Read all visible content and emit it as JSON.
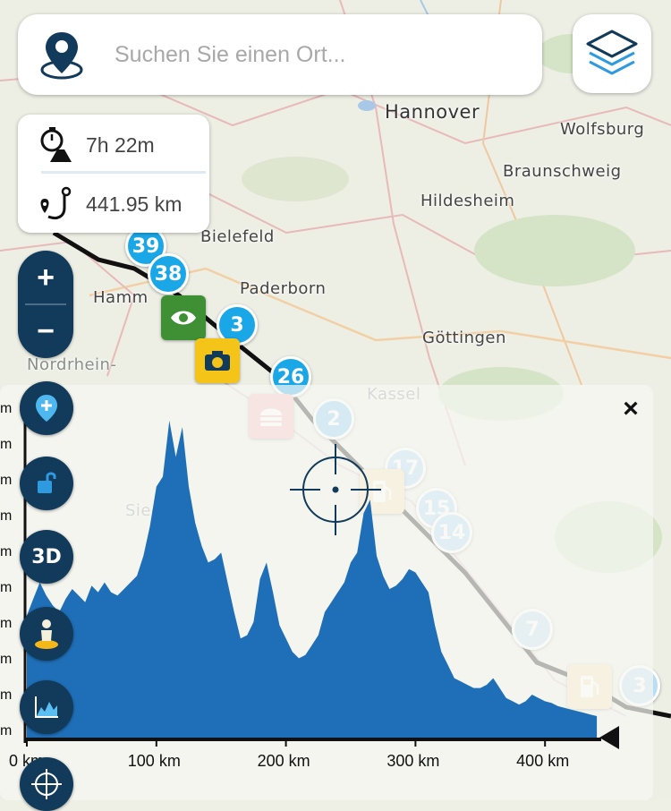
{
  "search": {
    "placeholder": "Suchen Sie einen Ort..."
  },
  "icons": {
    "search_pin": "location-pin-globe-icon",
    "layers": "layers-icon",
    "duration": "stopwatch-road-icon",
    "distance": "route-hook-icon",
    "zoom_in": "plus-icon",
    "zoom_out": "minus-icon",
    "add_waypoint": "map-pin-plus-icon",
    "lock": "unlock-icon",
    "street_view": "person-icon",
    "elevation": "elevation-chart-icon",
    "crosshair": "crosshair-icon",
    "close": "close-icon"
  },
  "route_info": {
    "duration": "7h 22m",
    "distance": "441.95 km"
  },
  "controls": {
    "zoom_in": "+",
    "zoom_out": "−",
    "view_3d": "3D",
    "close": "×"
  },
  "map": {
    "labels": [
      {
        "text": "Hannover",
        "x": 430,
        "y": 113,
        "cls": "big"
      },
      {
        "text": "Wolfsburg",
        "x": 626,
        "y": 134,
        "cls": ""
      },
      {
        "text": "Braunschweig",
        "x": 562,
        "y": 181,
        "cls": ""
      },
      {
        "text": "Hildesheim",
        "x": 470,
        "y": 214,
        "cls": ""
      },
      {
        "text": "Bielefeld",
        "x": 224,
        "y": 254,
        "cls": ""
      },
      {
        "text": "Paderborn",
        "x": 268,
        "y": 312,
        "cls": ""
      },
      {
        "text": "Hamm",
        "x": 104,
        "y": 322,
        "cls": ""
      },
      {
        "text": "Göttingen",
        "x": 472,
        "y": 367,
        "cls": ""
      },
      {
        "text": "Nordrhein-",
        "x": 30,
        "y": 397,
        "cls": "faint"
      },
      {
        "text": "Kassel",
        "x": 410,
        "y": 430,
        "cls": "faint"
      },
      {
        "text": "Siegen",
        "x": 140,
        "y": 560,
        "cls": "faint"
      }
    ],
    "route_markers": [
      {
        "label": "39",
        "x": 140,
        "y": 252,
        "color": "#1aa7e8"
      },
      {
        "label": "38",
        "x": 165,
        "y": 283,
        "color": "#1aa7e8"
      },
      {
        "label": "3",
        "x": 242,
        "y": 340,
        "color": "#1aa7e8"
      },
      {
        "label": "26",
        "x": 302,
        "y": 398,
        "color": "#1aa7e8"
      },
      {
        "label": "2",
        "x": 350,
        "y": 445,
        "color": "#7ec8f0"
      },
      {
        "label": "17",
        "x": 430,
        "y": 500,
        "color": "#a8d8f3"
      },
      {
        "label": "15",
        "x": 465,
        "y": 545,
        "color": "#a8d8f3"
      },
      {
        "label": "14",
        "x": 482,
        "y": 572,
        "color": "#a8d8f3"
      },
      {
        "label": "7",
        "x": 572,
        "y": 680,
        "color": "#b9def4"
      },
      {
        "label": "3",
        "x": 692,
        "y": 743,
        "color": "#b9def4"
      }
    ],
    "poi_markers": [
      {
        "kind": "eye",
        "x": 180,
        "y": 330,
        "color": "#3f8f35"
      },
      {
        "kind": "camera",
        "x": 218,
        "y": 378,
        "color": "#f4c419"
      },
      {
        "kind": "food",
        "x": 278,
        "y": 440,
        "color": "#f3b7bc"
      },
      {
        "kind": "fuel",
        "x": 402,
        "y": 524,
        "color": "#f6e3b4"
      },
      {
        "kind": "fuel",
        "x": 634,
        "y": 742,
        "color": "#f6e3b4"
      }
    ]
  },
  "chart_data": {
    "type": "area",
    "title": "",
    "xlabel": "",
    "ylabel": "",
    "x_unit": "km",
    "x_ticks": [
      "0 km",
      "100 km",
      "200 km",
      "300 km",
      "400 km"
    ],
    "xlim": [
      0,
      442
    ],
    "ylim": [
      0,
      1000
    ],
    "color": "#1f6fb8",
    "series": [
      {
        "x": [
          0,
          5,
          10,
          15,
          20,
          25,
          30,
          35,
          40,
          45,
          50,
          55,
          60,
          65,
          70,
          75,
          80,
          85,
          90,
          95,
          100,
          105,
          110,
          115,
          120,
          125,
          130,
          135,
          140,
          145,
          150,
          155,
          160,
          165,
          170,
          175,
          180,
          185,
          190,
          195,
          200,
          205,
          210,
          215,
          220,
          225,
          230,
          235,
          240,
          245,
          250,
          255,
          260,
          265,
          270,
          275,
          280,
          285,
          290,
          295,
          300,
          305,
          310,
          315,
          320,
          325,
          330,
          335,
          340,
          345,
          350,
          355,
          360,
          365,
          370,
          375,
          380,
          385,
          390,
          395,
          400,
          405,
          410,
          415,
          420,
          425,
          430,
          435,
          440
        ],
        "y": [
          370,
          420,
          470,
          430,
          400,
          380,
          420,
          450,
          430,
          410,
          460,
          440,
          470,
          440,
          430,
          450,
          470,
          490,
          550,
          640,
          760,
          790,
          960,
          850,
          940,
          760,
          650,
          580,
          530,
          540,
          560,
          470,
          380,
          300,
          310,
          350,
          480,
          530,
          440,
          340,
          300,
          260,
          240,
          250,
          280,
          310,
          380,
          410,
          440,
          470,
          530,
          560,
          680,
          720,
          550,
          490,
          450,
          460,
          480,
          510,
          500,
          470,
          440,
          340,
          260,
          220,
          180,
          170,
          160,
          150,
          150,
          160,
          180,
          150,
          120,
          110,
          100,
          110,
          130,
          120,
          110,
          105,
          95,
          90,
          85,
          80,
          75,
          70,
          65
        ]
      }
    ]
  }
}
